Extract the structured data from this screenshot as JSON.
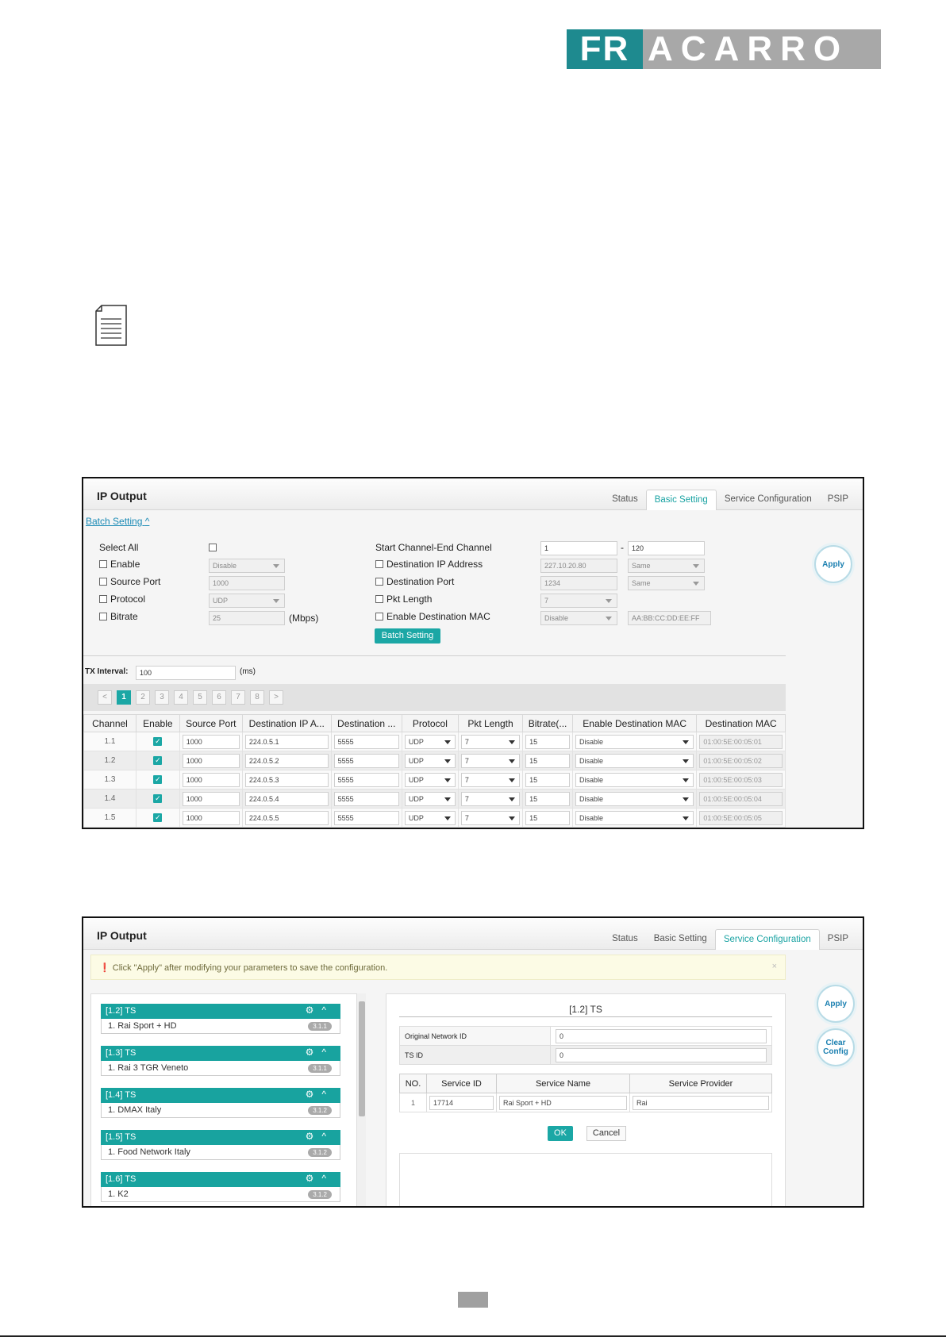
{
  "logo": {
    "part1": "FR",
    "part2": "ACARRO"
  },
  "colors": {
    "accent": "#1ba7a5",
    "logo_teal": "#1e8a8f",
    "logo_grey": "#a8a8a8"
  },
  "note_icon": "document-note-icon",
  "shot1": {
    "title": "IP Output",
    "tabs": [
      "Status",
      "Basic Setting",
      "Service Configuration",
      "PSIP"
    ],
    "active_tab": "Basic Setting",
    "batch_link": "Batch Setting",
    "batch": {
      "select_all": "Select All",
      "enable": {
        "label": "Enable",
        "value": "Disable"
      },
      "source_port": {
        "label": "Source Port",
        "value": "1000"
      },
      "protocol": {
        "label": "Protocol",
        "value": "UDP"
      },
      "bitrate": {
        "label": "Bitrate",
        "value": "25",
        "unit": "(Mbps)"
      },
      "start_end": {
        "label": "Start Channel-End Channel",
        "start": "1",
        "sep": "-",
        "end": "120"
      },
      "dest_ip": {
        "label": "Destination IP Address",
        "value": "227.10.20.80",
        "mode": "Same"
      },
      "dest_port": {
        "label": "Destination Port",
        "value": "1234",
        "mode": "Same"
      },
      "pkt_length": {
        "label": "Pkt Length",
        "value": "7"
      },
      "enable_mac": {
        "label": "Enable Destination MAC",
        "value": "Disable",
        "mac": "AA:BB:CC:DD:EE:FF"
      },
      "button": "Batch Setting"
    },
    "apply": "Apply",
    "tx": {
      "label": "TX Interval:",
      "value": "100",
      "unit": "(ms)"
    },
    "pager": [
      "<",
      "1",
      "2",
      "3",
      "4",
      "5",
      "6",
      "7",
      "8",
      ">"
    ],
    "columns": [
      "Channel",
      "Enable",
      "Source Port",
      "Destination IP A...",
      "Destination ...",
      "Protocol",
      "Pkt Length",
      "Bitrate(...",
      "Enable Destination MAC",
      "Destination MAC"
    ],
    "rows": [
      {
        "channel": "1.1",
        "source_port": "1000",
        "dest_ip": "224.0.5.1",
        "dest_port": "5555",
        "protocol": "UDP",
        "pkt": "7",
        "bitrate": "15",
        "enable_mac": "Disable",
        "mac": "01:00:5E:00:05:01"
      },
      {
        "channel": "1.2",
        "source_port": "1000",
        "dest_ip": "224.0.5.2",
        "dest_port": "5555",
        "protocol": "UDP",
        "pkt": "7",
        "bitrate": "15",
        "enable_mac": "Disable",
        "mac": "01:00:5E:00:05:02"
      },
      {
        "channel": "1.3",
        "source_port": "1000",
        "dest_ip": "224.0.5.3",
        "dest_port": "5555",
        "protocol": "UDP",
        "pkt": "7",
        "bitrate": "15",
        "enable_mac": "Disable",
        "mac": "01:00:5E:00:05:03"
      },
      {
        "channel": "1.4",
        "source_port": "1000",
        "dest_ip": "224.0.5.4",
        "dest_port": "5555",
        "protocol": "UDP",
        "pkt": "7",
        "bitrate": "15",
        "enable_mac": "Disable",
        "mac": "01:00:5E:00:05:04"
      },
      {
        "channel": "1.5",
        "source_port": "1000",
        "dest_ip": "224.0.5.5",
        "dest_port": "5555",
        "protocol": "UDP",
        "pkt": "7",
        "bitrate": "15",
        "enable_mac": "Disable",
        "mac": "01:00:5E:00:05:05"
      }
    ]
  },
  "shot2": {
    "title": "IP Output",
    "tabs": [
      "Status",
      "Basic Setting",
      "Service Configuration",
      "PSIP"
    ],
    "active_tab": "Service Configuration",
    "notice": "Click \"Apply\" after modifying your parameters to save the configuration.",
    "close": "×",
    "ts_list": [
      {
        "header": "[1.2] TS",
        "item": "1. Rai Sport + HD",
        "badge": "3.1.1"
      },
      {
        "header": "[1.3] TS",
        "item": "1. Rai 3 TGR Veneto",
        "badge": "3.1.1"
      },
      {
        "header": "[1.4] TS",
        "item": "1. DMAX Italy",
        "badge": "3.1.2"
      },
      {
        "header": "[1.5] TS",
        "item": "1. Food Network Italy",
        "badge": "3.1.2"
      },
      {
        "header": "[1.6] TS",
        "item": "1. K2",
        "badge": "3.1.2"
      }
    ],
    "detail": {
      "title": "[1.2] TS",
      "onid_label": "Original Network ID",
      "onid": "0",
      "tsid_label": "TS ID",
      "tsid": "0",
      "columns": [
        "NO.",
        "Service ID",
        "Service Name",
        "Service Provider"
      ],
      "row": {
        "no": "1",
        "service_id": "17714",
        "service_name": "Rai Sport + HD",
        "provider": "Rai"
      },
      "ok": "OK",
      "cancel": "Cancel"
    },
    "apply": "Apply",
    "clear_config": [
      "Clear",
      "Config"
    ]
  }
}
